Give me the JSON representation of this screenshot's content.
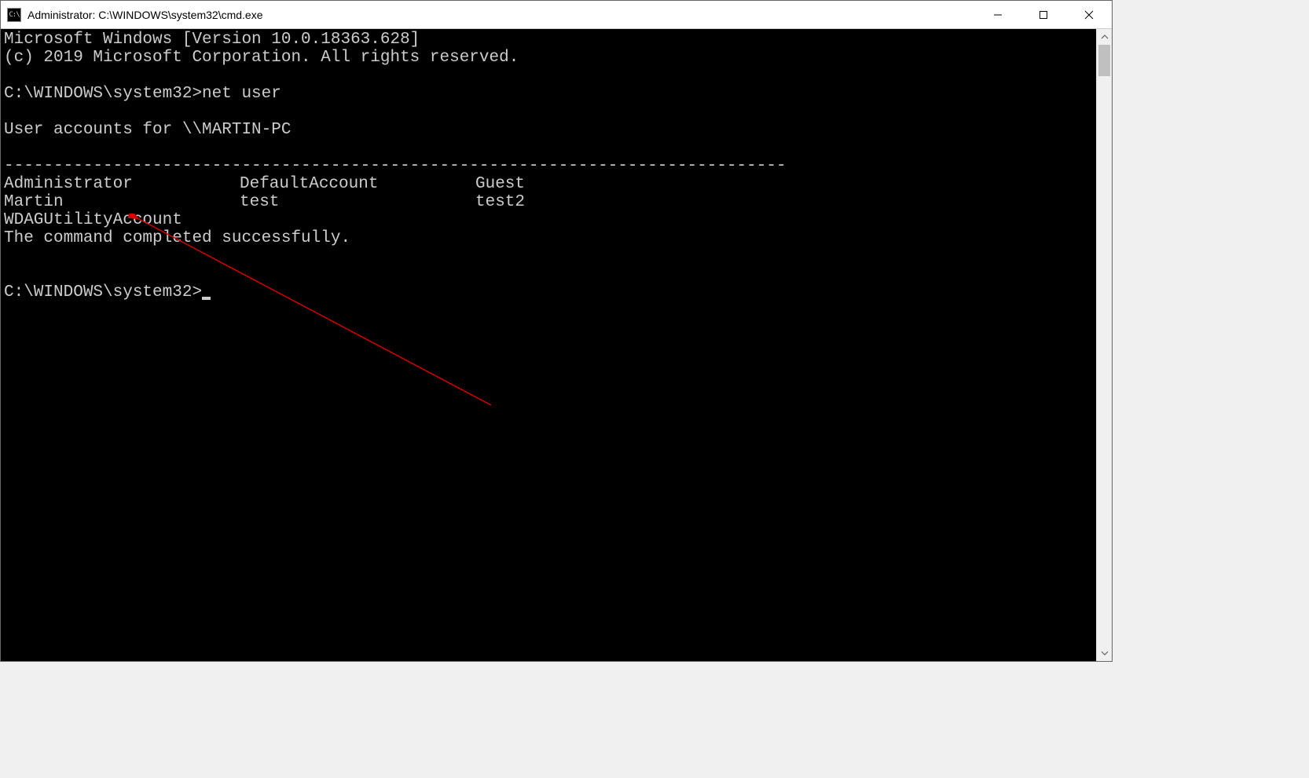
{
  "window": {
    "title": "Administrator: C:\\WINDOWS\\system32\\cmd.exe"
  },
  "terminal": {
    "header_line1": "Microsoft Windows [Version 10.0.18363.628]",
    "header_line2": "(c) 2019 Microsoft Corporation. All rights reserved.",
    "prompt1": "C:\\WINDOWS\\system32>",
    "command1": "net user",
    "output_header": "User accounts for \\\\MARTIN-PC",
    "separator": "-------------------------------------------------------------------------------",
    "users_row1_col1": "Administrator",
    "users_row1_col2": "DefaultAccount",
    "users_row1_col3": "Guest",
    "users_row2_col1": "Martin",
    "users_row2_col2": "test",
    "users_row2_col3": "test2",
    "users_row3_col1": "WDAGUtilityAccount",
    "completion_msg": "The command completed successfully.",
    "prompt2": "C:\\WINDOWS\\system32>"
  },
  "annotation": {
    "arrow_color": "#d40000"
  }
}
